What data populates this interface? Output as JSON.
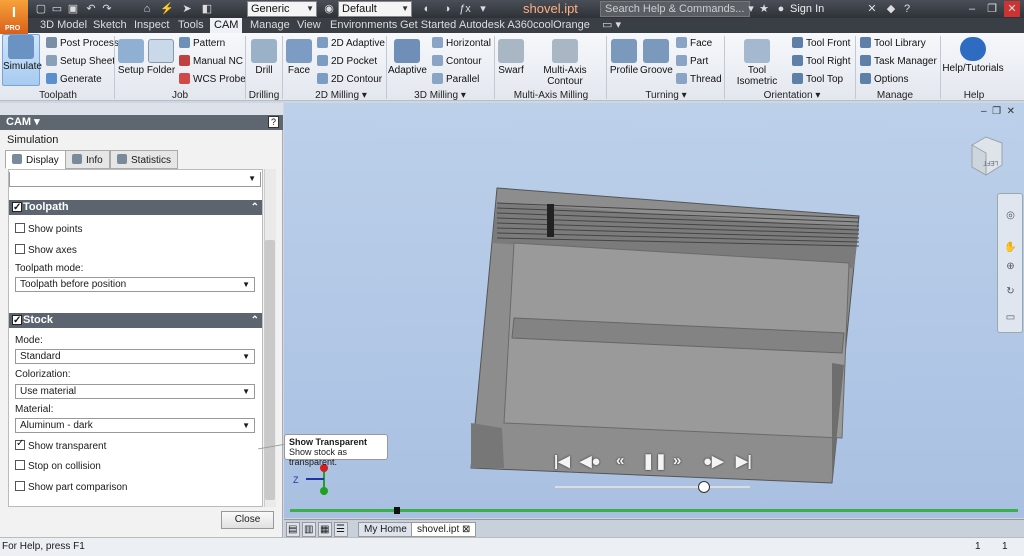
{
  "app": {
    "logo_letter": "I",
    "edition": "PRO",
    "document_title": "shovel.ipt"
  },
  "qat": {
    "appearance_combo": "Generic",
    "material_combo": "Default",
    "fx": "ƒx"
  },
  "search": {
    "placeholder": "Search Help & Commands..."
  },
  "account": {
    "sign_in": "Sign In"
  },
  "menu_tabs": [
    "3D Model",
    "Sketch",
    "Inspect",
    "Tools",
    "CAM",
    "Manage",
    "View",
    "Environments",
    "Get Started",
    "Autodesk A360",
    "coolOrange"
  ],
  "active_menu_tab": "CAM",
  "ribbon": {
    "toolpath": {
      "simulate": "Simulate",
      "post_process": "Post Process",
      "setup_sheet": "Setup Sheet",
      "generate": "Generate",
      "panel": "Toolpath"
    },
    "job": {
      "setup": "Setup",
      "folder": "Folder",
      "pattern": "Pattern",
      "manual_nc": "Manual NC",
      "wcs_probe": "WCS Probe",
      "panel": "Job"
    },
    "drilling": {
      "drill": "Drill",
      "panel": "Drilling"
    },
    "milling2d": {
      "face": "Face",
      "adaptive": "2D Adaptive",
      "pocket": "2D Pocket",
      "contour": "2D Contour",
      "panel": "2D Milling"
    },
    "milling3d": {
      "adaptive": "Adaptive",
      "horizontal": "Horizontal",
      "contour": "Contour",
      "parallel": "Parallel",
      "panel": "3D Milling"
    },
    "multiaxis": {
      "swarf": "Swarf",
      "contour": "Multi-Axis Contour",
      "panel": "Multi-Axis Milling"
    },
    "turning": {
      "profile": "Profile",
      "groove": "Groove",
      "face": "Face",
      "part": "Part",
      "thread": "Thread",
      "panel": "Turning"
    },
    "orientation": {
      "isometric": "Tool Isometric",
      "front": "Tool Front",
      "right": "Tool Right",
      "top": "Tool Top",
      "panel": "Orientation"
    },
    "manage": {
      "library": "Tool Library",
      "task": "Task Manager",
      "options": "Options",
      "panel": "Manage"
    },
    "help": {
      "tutorials": "Help/Tutorials",
      "panel": "Help"
    }
  },
  "panel": {
    "header": "CAM",
    "subtitle": "Simulation",
    "tabs": [
      "Display",
      "Info",
      "Statistics"
    ],
    "toolpath_group": {
      "title": "Toolpath",
      "show_points": "Show points",
      "show_axes": "Show axes",
      "mode_label": "Toolpath mode:",
      "mode_value": "Toolpath before position"
    },
    "stock_group": {
      "title": "Stock",
      "mode_label": "Mode:",
      "mode_value": "Standard",
      "colorization_label": "Colorization:",
      "colorization_value": "Use material",
      "material_label": "Material:",
      "material_value": "Aluminum - dark",
      "show_transparent": "Show transparent",
      "stop_on_collision": "Stop on collision",
      "show_part_comparison": "Show part comparison"
    },
    "close": "Close"
  },
  "tooltip": {
    "title": "Show Transparent",
    "body": "Show stock as transparent."
  },
  "viewcube": {
    "face_label": "LEFT"
  },
  "triad": {
    "z_label": "Z"
  },
  "doc_tabs": [
    "My Home",
    "shovel.ipt"
  ],
  "status": {
    "help_text": "For Help, press F1",
    "count_a": "1",
    "count_b": "1"
  }
}
